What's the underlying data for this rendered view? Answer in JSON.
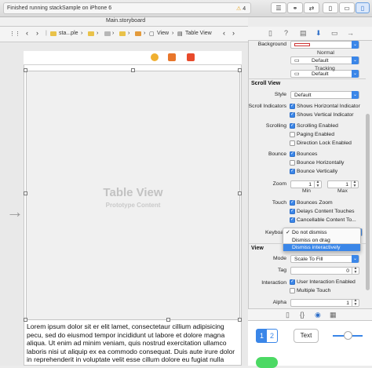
{
  "toolbar": {
    "status": "Finished running stackSample on iPhone 6",
    "warning_count": "4"
  },
  "jumpbar": {
    "title": "Main.storyboard"
  },
  "breadcrumb": [
    "sta...ple",
    "...",
    "...",
    "...",
    "View",
    "Table View"
  ],
  "canvas": {
    "table_title": "Table View",
    "table_subtitle": "Prototype Content",
    "lorem": "Lorem ipsum dolor sit er elit lamet, consectetaur cillium adipisicing pecu, sed do eiusmod tempor incididunt ut labore et dolore magna aliqua. Ut enim ad minim veniam, quis nostrud exercitation ullamco laboris nisi ut aliquip ex ea commodo consequat. Duis aute irure dolor in reprehenderit in voluptate velit esse cillum dolore eu fugiat nulla pariatur."
  },
  "inspector": {
    "background_label": "Background",
    "background_value": "Default",
    "background_sub": "Normal",
    "tint_value": "Default",
    "tint_sub": "Tracking",
    "scroll_view_header": "Scroll View",
    "style_label": "Style",
    "style_value": "Default",
    "indicators_label": "Scroll Indicators",
    "show_horizontal": "Shows Horizontal Indicator",
    "show_vertical": "Shows Vertical Indicator",
    "scrolling_label": "Scrolling",
    "scrolling_enabled": "Scrolling Enabled",
    "paging_enabled": "Paging Enabled",
    "direction_lock": "Direction Lock Enabled",
    "bounce_label": "Bounce",
    "bounces": "Bounces",
    "bounce_h": "Bounce Horizontally",
    "bounce_v": "Bounce Vertically",
    "zoom_label": "Zoom",
    "zoom_min": "1",
    "zoom_max": "1",
    "zoom_min_label": "Min",
    "zoom_max_label": "Max",
    "touch_label": "Touch",
    "bounces_zoom": "Bounces Zoom",
    "delays_touches": "Delays Content Touches",
    "cancellable_touches": "Cancellable Content To...",
    "keyboard_label": "Keyboa",
    "view_header": "View",
    "mode_label": "Mode",
    "mode_value": "Scale To Fill",
    "tag_label": "Tag",
    "tag_value": "0",
    "interaction_label": "Interaction",
    "user_interaction": "User Interaction Enabled",
    "multiple_touch": "Multiple Touch",
    "alpha_label": "Alpha",
    "alpha_value": "1"
  },
  "keyboard_dropdown": {
    "options": [
      "Do not dismiss",
      "Dismiss on drag",
      "Dismiss interactively"
    ],
    "checked": "Do not dismiss",
    "highlighted": "Dismiss interactively"
  },
  "library": {
    "segment_1": "1",
    "segment_2": "2",
    "text_label": "Text"
  },
  "colors": {
    "accent": "#3a86e8",
    "warning": "#e8a21a",
    "folder": "#e9c24a"
  }
}
